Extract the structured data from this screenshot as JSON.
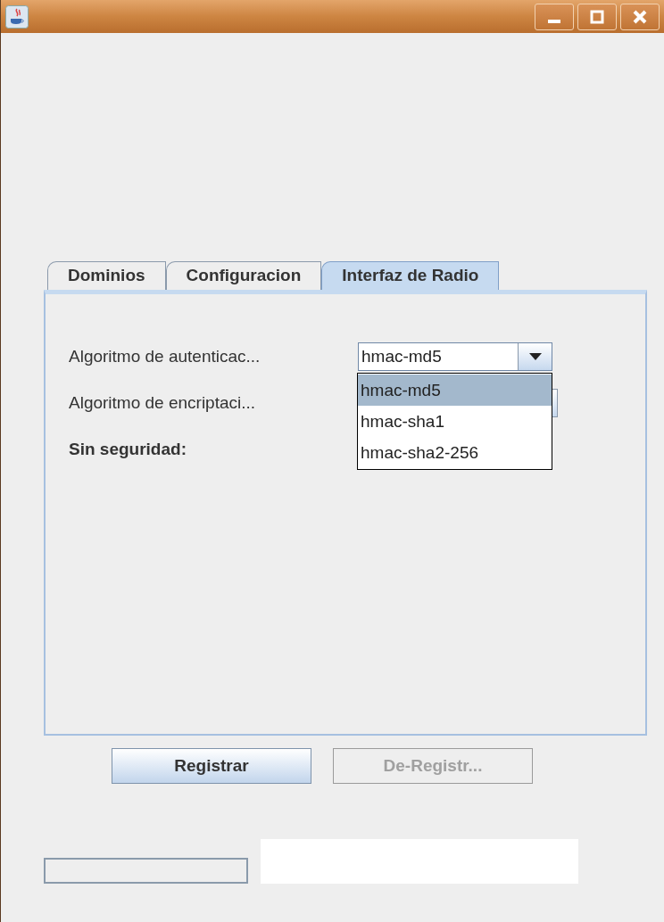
{
  "tabs": [
    {
      "label": "Dominios",
      "selected": false
    },
    {
      "label": "Configuracion",
      "selected": false
    },
    {
      "label": "Interfaz de Radio",
      "selected": true
    }
  ],
  "rows": [
    {
      "kind": "combo",
      "label": "Algoritmo de autenticac...",
      "value": "hmac-md5",
      "expanded": true,
      "options": [
        {
          "label": "hmac-md5",
          "selected": true
        },
        {
          "label": "hmac-sha1",
          "selected": false
        },
        {
          "label": "hmac-sha2-256",
          "selected": false
        }
      ]
    },
    {
      "kind": "combo",
      "label": "Algoritmo de encriptaci..."
    },
    {
      "kind": "label",
      "label": "Sin seguridad:"
    }
  ],
  "buttons": [
    {
      "label": "Registrar",
      "disabled": false
    },
    {
      "label": "De-Registr...",
      "disabled": true
    }
  ],
  "progress": {
    "level": 0
  }
}
